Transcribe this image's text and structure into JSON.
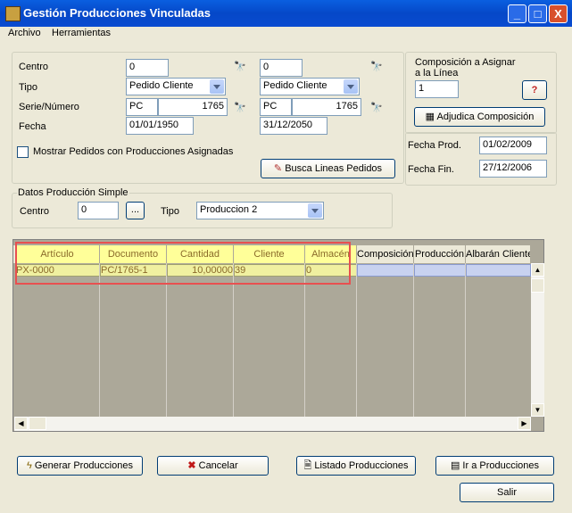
{
  "window": {
    "title": "Gestión Producciones Vinculadas",
    "minimize": "_",
    "maximize": "□",
    "close": "X"
  },
  "menu": {
    "archivo": "Archivo",
    "herramientas": "Herramientas"
  },
  "filters": {
    "centro_label": "Centro",
    "centro_from": "0",
    "centro_to": "0",
    "tipo_label": "Tipo",
    "tipo_from": "Pedido Cliente",
    "tipo_to": "Pedido Cliente",
    "serie_label": "Serie/Número",
    "serie_from": "PC",
    "numero_from": "1765",
    "serie_to": "PC",
    "numero_to": "1765",
    "fecha_label": "Fecha",
    "fecha_from": "01/01/1950",
    "fecha_to": "31/12/2050",
    "mostrar_label": "Mostrar Pedidos con Producciones Asignadas",
    "busca_button": "Busca Lineas Pedidos"
  },
  "composicion": {
    "label_line1": "Composición a Asignar",
    "label_line2": "a la Línea",
    "value": "1",
    "adjudica_button": "Adjudica Composición",
    "fecha_prod_label": "Fecha Prod.",
    "fecha_prod": "01/02/2009",
    "fecha_fin_label": "Fecha Fin.",
    "fecha_fin": "27/12/2006"
  },
  "simple": {
    "legend": "Datos Producción Simple",
    "centro_label": "Centro",
    "centro": "0",
    "browse": "...",
    "tipo_label": "Tipo",
    "tipo": "Produccion 2"
  },
  "grid": {
    "columns": [
      "Artículo",
      "Documento",
      "Cantidad",
      "Cliente",
      "Almacén",
      "Composición",
      "Producción",
      "Albarán Cliente"
    ],
    "rows": [
      [
        "PX-0000",
        "PC/1765-1",
        "10,00000",
        "39",
        "0",
        "",
        "",
        ""
      ]
    ]
  },
  "buttons": {
    "generar": "Generar Producciones",
    "cancelar": "Cancelar",
    "listado": "Listado Producciones",
    "ir": "Ir a Producciones",
    "salir": "Salir"
  }
}
